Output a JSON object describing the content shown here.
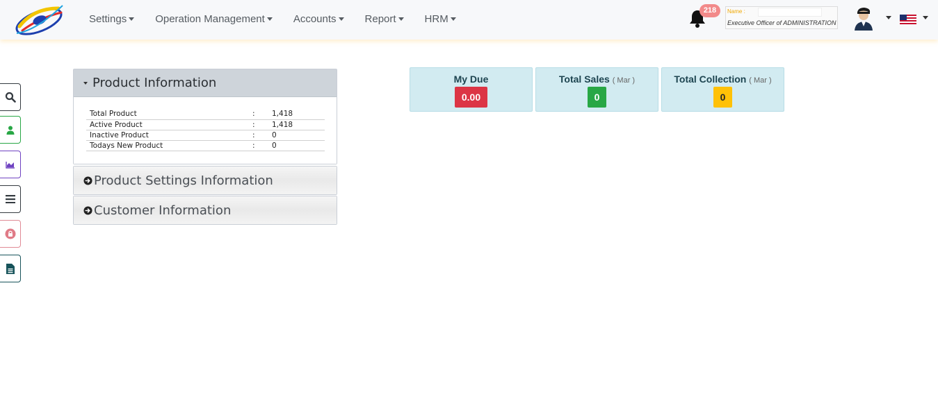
{
  "nav": {
    "menu": [
      {
        "label": "Settings"
      },
      {
        "label": "Operation Management"
      },
      {
        "label": "Accounts"
      },
      {
        "label": "Report"
      },
      {
        "label": "HRM"
      }
    ],
    "notification_count": "218",
    "user": {
      "name_label": "Name :",
      "name_value": "",
      "role": "Executive Officer of ADMINISTRATION"
    },
    "language": "en-US"
  },
  "sidebar": {
    "buttons": [
      {
        "icon": "search-icon",
        "color": "#343a40"
      },
      {
        "icon": "user-icon",
        "color": "#28a745"
      },
      {
        "icon": "area-chart-icon",
        "color": "#6f42c1"
      },
      {
        "icon": "list-icon",
        "color": "#343a40"
      },
      {
        "icon": "lock-icon",
        "color": "#dc3545"
      },
      {
        "icon": "file-icon",
        "color": "#17535a"
      }
    ]
  },
  "panels": {
    "product": {
      "title": "Product Information",
      "rows": [
        {
          "label": "Total Product",
          "sep": ":",
          "value": "1,418"
        },
        {
          "label": "Active Product",
          "sep": ":",
          "value": "1,418"
        },
        {
          "label": "Inactive Product",
          "sep": ":",
          "value": "0"
        },
        {
          "label": "Todays New Product",
          "sep": ":",
          "value": "0"
        }
      ]
    },
    "product_settings": {
      "title": "Product Settings Information"
    },
    "customer": {
      "title": "Customer Information"
    }
  },
  "cards": [
    {
      "title": "My Due",
      "sub": "",
      "value": "0.00",
      "bg": "#dc3545",
      "fg": "#ffffff"
    },
    {
      "title": "Total Sales",
      "sub": "( Mar )",
      "value": "0",
      "bg": "#28a745",
      "fg": "#ffffff"
    },
    {
      "title": "Total Collection",
      "sub": "( Mar )",
      "value": "0",
      "bg": "#ffc107",
      "fg": "#212529"
    }
  ]
}
